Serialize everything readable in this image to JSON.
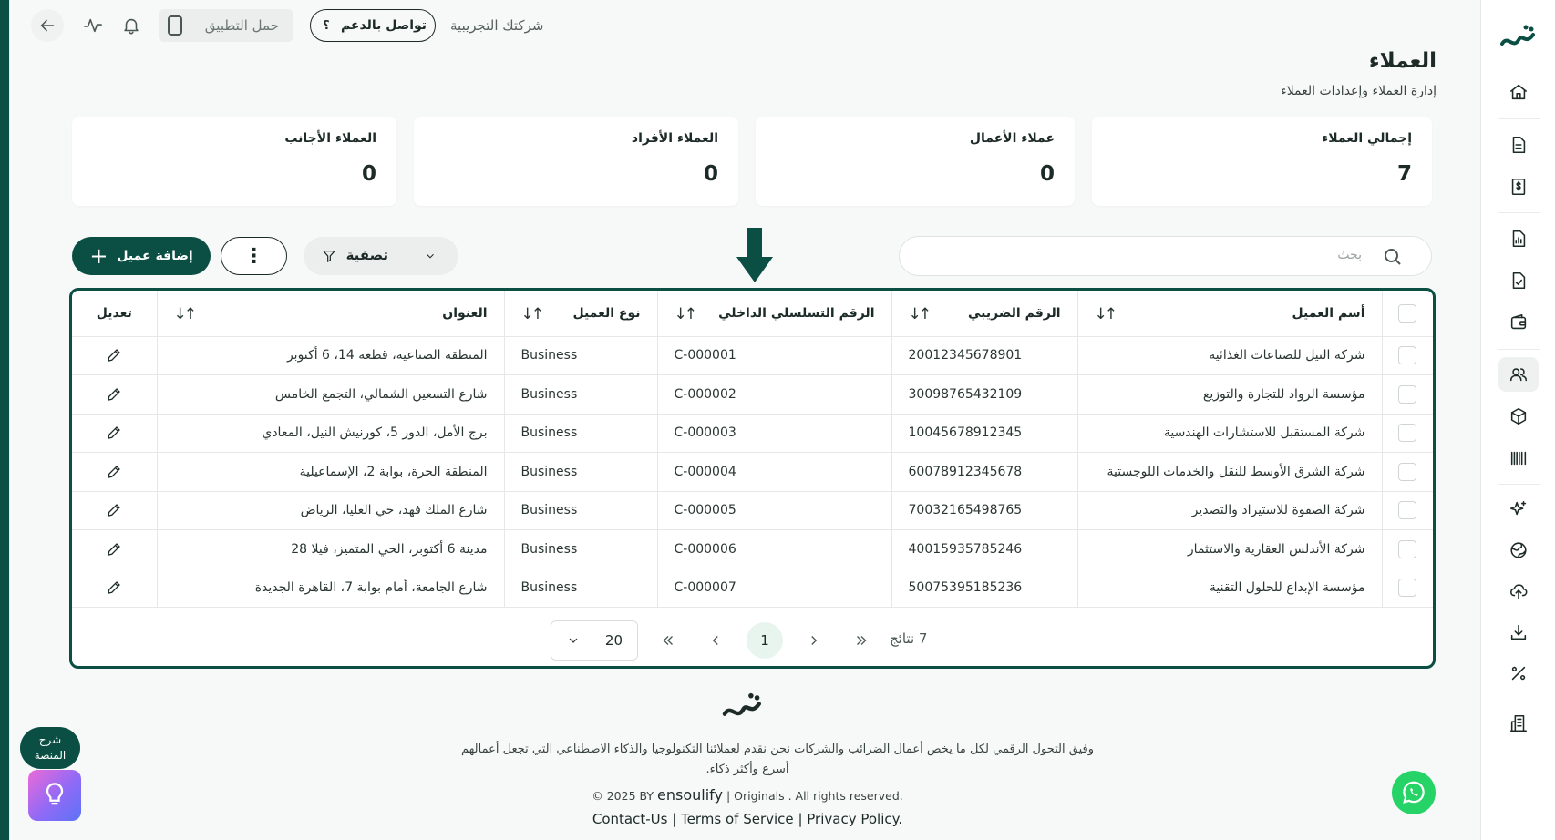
{
  "topbar": {
    "company": "شركتك التجريبية",
    "support_label": "تواصل بالدعم",
    "support_glyph": "؟",
    "download_app_label": "حمل التطبيق"
  },
  "header": {
    "title": "العملاء",
    "subtitle": "إدارة العملاء وإعدادات العملاء"
  },
  "stats": [
    {
      "label": "إجمالي العملاء",
      "value": "7"
    },
    {
      "label": "عملاء الأعمال",
      "value": "0"
    },
    {
      "label": "العملاء الأفراد",
      "value": "0"
    },
    {
      "label": "العملاء الأجانب",
      "value": "0"
    }
  ],
  "toolbar": {
    "search_placeholder": "بحث",
    "filter_label": "تصفية",
    "more_glyph": "⋮",
    "add_label": "إضافة عميل"
  },
  "table": {
    "columns": {
      "name": "أسم العميل",
      "tax": "الرقم الضريبي",
      "serial": "الرقم التسلسلي الداخلي",
      "type": "نوع العميل",
      "address": "العنوان",
      "edit": "تعديل"
    },
    "rows": [
      {
        "name": "شركة النيل للصناعات الغذائية",
        "tax": "20012345678901",
        "serial": "C-000001",
        "type": "Business",
        "address": "المنطقة الصناعية، قطعة 14، 6 أكتوبر"
      },
      {
        "name": "مؤسسة الرواد للتجارة والتوزيع",
        "tax": "30098765432109",
        "serial": "C-000002",
        "type": "Business",
        "address": "شارع التسعين الشمالي، التجمع الخامس"
      },
      {
        "name": "شركة المستقبل للاستشارات الهندسية",
        "tax": "10045678912345",
        "serial": "C-000003",
        "type": "Business",
        "address": "برج الأمل، الدور 5، كورنيش النيل، المعادي"
      },
      {
        "name": "شركة الشرق الأوسط للنقل والخدمات اللوجستية",
        "tax": "60078912345678",
        "serial": "C-000004",
        "type": "Business",
        "address": "المنطقة الحرة، بوابة 2، الإسماعيلية"
      },
      {
        "name": "شركة الصفوة للاستيراد والتصدير",
        "tax": "70032165498765",
        "serial": "C-000005",
        "type": "Business",
        "address": "شارع الملك فهد، حي العليا، الرياض"
      },
      {
        "name": "شركة الأندلس العقارية والاستثمار",
        "tax": "40015935785246",
        "serial": "C-000006",
        "type": "Business",
        "address": "مدينة 6 أكتوبر، الحي المتميز، فيلا 28"
      },
      {
        "name": "مؤسسة الإبداع للحلول التقنية",
        "tax": "50075395185236",
        "serial": "C-000007",
        "type": "Business",
        "address": "شارع الجامعة، أمام بوابة 7، القاهرة الجديدة"
      }
    ]
  },
  "pagination": {
    "page_size": "20",
    "current_page": "1",
    "total_text": "7 نتائج"
  },
  "footer": {
    "tagline_line1": "وفيق التحول الرقمي لكل ما يخص أعمال الضرائب والشركات نحن نقدم لعملائنا التكنولوجيا والذكاء الاصطناعي التي تجعل أعمالهم",
    "tagline_line2": "أسرع وأكثر ذكاء.",
    "copyright_prefix": "© 2025 BY",
    "brand": "ensoulify",
    "copyright_suffix": "| Originals . All rights reserved.",
    "links": [
      "Contact-Us",
      "Terms of Service",
      "Privacy Policy."
    ]
  },
  "help": {
    "line1": "شرح",
    "line2": "المنصة"
  },
  "colors": {
    "brand": "#0b4f44",
    "page_bg": "#f7f8f8",
    "current_page_bg": "#e8f5ee",
    "whatsapp": "#25d366"
  }
}
